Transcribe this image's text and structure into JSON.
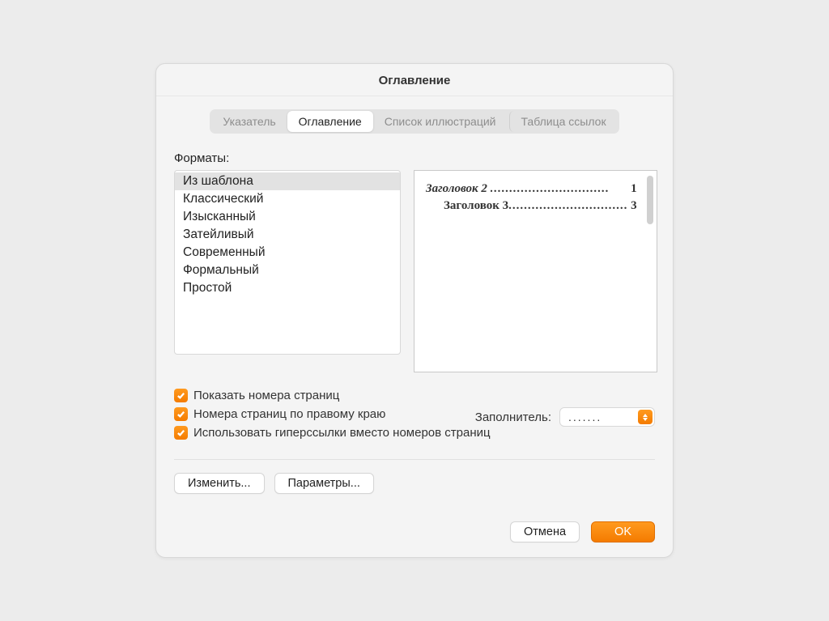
{
  "title": "Оглавление",
  "tabs": {
    "index": "Указатель",
    "toc": "Оглавление",
    "illustrations": "Список иллюстраций",
    "refs": "Таблица ссылок"
  },
  "formats_label": "Форматы:",
  "formats": [
    "Из шаблона",
    "Классический",
    "Изысканный",
    "Затейливый",
    "Современный",
    "Формальный",
    "Простой"
  ],
  "preview": {
    "line1_text": "Заголовок 2",
    "line1_page": "1",
    "line2_text": "Заголовок 3",
    "line2_page": "3",
    "dots": "..............................."
  },
  "checks": {
    "show_pages": "Показать номера страниц",
    "right_align": "Номера страниц по правому краю",
    "hyperlinks": "Использовать гиперссылки вместо номеров страниц"
  },
  "filler_label": "Заполнитель:",
  "filler_value": ".......",
  "buttons": {
    "modify": "Изменить...",
    "options": "Параметры...",
    "cancel": "Отмена",
    "ok": "OK"
  }
}
